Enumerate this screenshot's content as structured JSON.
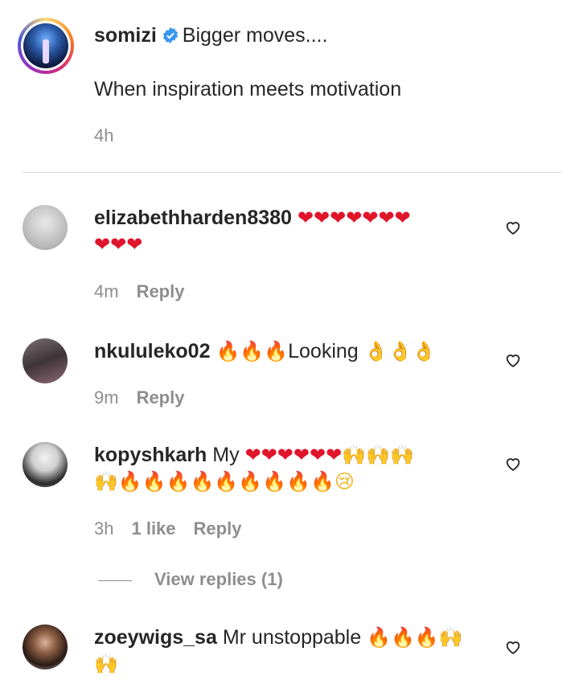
{
  "post": {
    "username": "somizi",
    "verified": true,
    "caption_line1": "Bigger moves....",
    "caption_line2": "When inspiration meets motivation",
    "time": "4h"
  },
  "comments": [
    {
      "username": "elizabethharden8380",
      "text_line1": "❤❤❤❤❤❤❤",
      "text_line2": "❤❤❤",
      "time": "4m",
      "reply_label": "Reply",
      "avatar_color": "#cfcfcf"
    },
    {
      "username": "nkululeko02",
      "fire": "🔥🔥🔥",
      "text": "Looking",
      "ok": "👌👌👌",
      "time": "9m",
      "reply_label": "Reply",
      "avatar_color": "#5a4b4f"
    },
    {
      "username": "kopyshkarh",
      "text": "My",
      "hearts": "❤❤❤❤❤❤",
      "raise1": "🙌🙌🙌",
      "raise2": "🙌",
      "fire": "🔥🔥🔥🔥🔥🔥🔥🔥🔥",
      "cry": "😢",
      "time": "3h",
      "likes": "1 like",
      "reply_label": "Reply",
      "avatar_color": "#4a4a4a"
    },
    {
      "username": "zoeywigs_sa",
      "text": "Mr unstoppable",
      "fire": "🔥🔥🔥",
      "raise1": "🙌",
      "raise2": "🙌",
      "avatar_color": "#3a2a22"
    }
  ],
  "view_replies_label": "View replies (1)",
  "icons": {
    "verified": "verified-badge-icon",
    "like": "heart-outline-icon"
  }
}
